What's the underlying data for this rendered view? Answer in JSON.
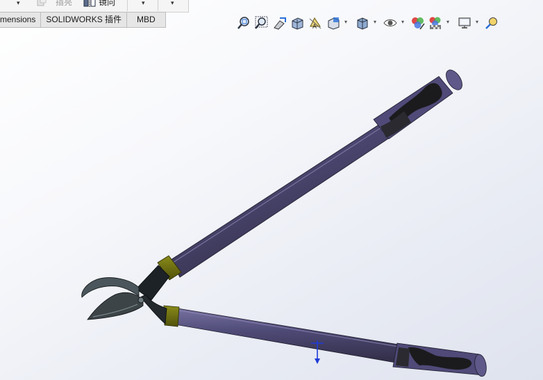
{
  "command_bar": {
    "items": [
      {
        "label": "插亮",
        "state": "disabled",
        "icon": "insert-icon"
      },
      {
        "label": "镜向",
        "state": "enabled",
        "icon": "mirror-icon"
      }
    ]
  },
  "tabs": [
    {
      "label": "mensions"
    },
    {
      "label": "SOLIDWORKS 插件"
    },
    {
      "label": "MBD"
    }
  ],
  "heads_up_toolbar": [
    {
      "icon": "zoom-to-fit-icon",
      "dropdown": false
    },
    {
      "icon": "zoom-to-area-icon",
      "dropdown": false
    },
    {
      "icon": "previous-view-icon",
      "dropdown": false
    },
    {
      "icon": "section-view-icon",
      "dropdown": false
    },
    {
      "icon": "dynamic-annotation-views-icon",
      "dropdown": false
    },
    {
      "icon": "view-orientation-icon",
      "dropdown": true
    },
    {
      "icon": "display-style-icon",
      "dropdown": true
    },
    {
      "icon": "hide-show-items-icon",
      "dropdown": true
    },
    {
      "icon": "edit-appearance-icon",
      "dropdown": false
    },
    {
      "icon": "apply-scene-icon",
      "dropdown": true
    },
    {
      "icon": "view-settings-icon",
      "dropdown": true
    },
    {
      "icon": "realview-graphics-icon",
      "dropdown": false
    }
  ],
  "model": {
    "name": "lopping-shears-3d-model",
    "colors": {
      "handle": "#4b4770",
      "handle_highlight": "#6a6592",
      "grip": "#1b1b1e",
      "ferrule": "#6b6c10",
      "blade": "#3c4448",
      "triad_axis": "#1f3bd8"
    }
  }
}
